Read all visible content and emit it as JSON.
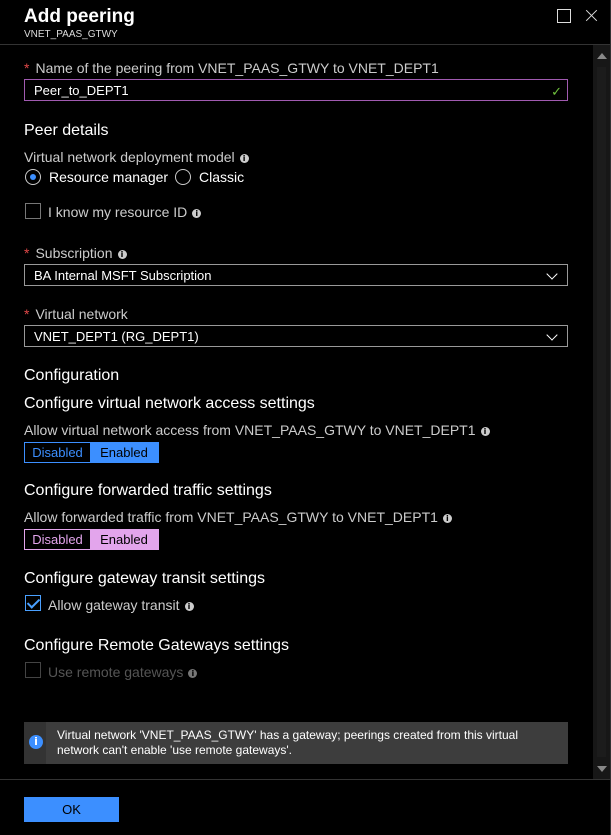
{
  "header": {
    "title": "Add peering",
    "subtitle": "VNET_PAAS_GTWY",
    "info_glyph": "i"
  },
  "peering_name": {
    "label": "Name of the peering from VNET_PAAS_GTWY to VNET_DEPT1",
    "value": "Peer_to_DEPT1",
    "valid_mark": "✓"
  },
  "peer_details": {
    "heading": "Peer details",
    "deployment_model_label": "Virtual network deployment model",
    "options": [
      "Resource manager",
      "Classic"
    ],
    "selected": "Resource manager",
    "resource_id_label": "I know my resource ID",
    "resource_id_checked": false
  },
  "subscription": {
    "label": "Subscription",
    "value": "BA Internal MSFT Subscription"
  },
  "virtual_network": {
    "label": "Virtual network",
    "value": "VNET_DEPT1 (RG_DEPT1)"
  },
  "configuration": {
    "heading": "Configuration",
    "access": {
      "heading": "Configure virtual network access settings",
      "label": "Allow virtual network access from VNET_PAAS_GTWY to VNET_DEPT1",
      "options": [
        "Disabled",
        "Enabled"
      ],
      "selected": "Enabled"
    },
    "forwarded": {
      "heading": "Configure forwarded traffic settings",
      "label": "Allow forwarded traffic from VNET_PAAS_GTWY to VNET_DEPT1",
      "options": [
        "Disabled",
        "Enabled"
      ],
      "selected": "Enabled"
    },
    "gateway_transit": {
      "heading": "Configure gateway transit settings",
      "label": "Allow gateway transit",
      "checked": true
    },
    "remote_gateways": {
      "heading": "Configure Remote Gateways settings",
      "label": "Use remote gateways",
      "checked": false,
      "disabled": true
    }
  },
  "info_message": "Virtual network 'VNET_PAAS_GTWY' has a gateway; peerings created from this virtual network can't enable 'use remote gateways'.",
  "footer": {
    "ok_label": "OK"
  },
  "colors": {
    "accent": "#3c8fff",
    "toggle_forwarded": "#e3a5ec",
    "required": "#e04848",
    "valid": "#6fc13d"
  }
}
